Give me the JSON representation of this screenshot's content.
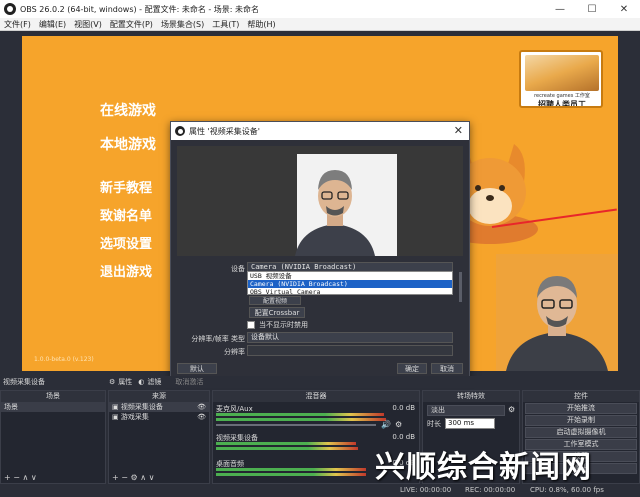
{
  "window": {
    "title": "OBS 26.0.2 (64-bit, windows) - 配置文件: 未命名 - 场景: 未命名",
    "minimize": "—",
    "maximize": "☐",
    "close": "✕"
  },
  "menu": [
    "文件(F)",
    "编辑(E)",
    "视图(V)",
    "配置文件(P)",
    "场景集合(S)",
    "工具(T)",
    "帮助(H)"
  ],
  "scene_menu": [
    "在线游戏",
    "本地游戏",
    "新手教程",
    "致谢名单",
    "选项设置",
    "退出游戏"
  ],
  "version_text": "1.0.0-beta.0 (v.123)",
  "badge": {
    "line1": "recreate games 工作室",
    "line2": "招聘人类员工"
  },
  "dialog": {
    "title": "属性 '视频采集设备'",
    "device_label": "设备",
    "device_value": "Camera (NVIDIA Broadcast)",
    "options": [
      "USB 视频设备",
      "Camera (NVIDIA Broadcast)",
      "OBS Virtual Camera"
    ],
    "hidden_btn": "配置视频",
    "crossbar_btn": "配置Crossbar",
    "checkbox_label": "当不显示时禁用",
    "res_type_label": "分辨率/帧率 类型",
    "res_type_value": "设备默认",
    "res_label": "分辨率",
    "default_btn": "默认",
    "ok_btn": "确定",
    "cancel_btn": "取消"
  },
  "source_bar": {
    "name": "视频采集设备",
    "props": "属性",
    "filters": "滤镜",
    "deactivate": "取消激活"
  },
  "docks": {
    "scenes": {
      "header": "场景",
      "items": [
        "场景"
      ],
      "footer": "+  −  ∧  ∨"
    },
    "sources": {
      "header": "来源",
      "items": [
        "视频采集设备",
        "游戏采集"
      ],
      "footer": "+  −  ⚙  ∧  ∨"
    },
    "mixer": {
      "header": "混音器",
      "channels": [
        {
          "name": "麦克风/Aux",
          "db": "0.0 dB"
        },
        {
          "name": "视频采集设备",
          "db": "0.0 dB"
        },
        {
          "name": "桌面音频",
          "db": "0.0 dB"
        }
      ]
    },
    "transitions": {
      "header": "转场特效",
      "type": "淡出",
      "duration_label": "时长",
      "duration": "300 ms"
    },
    "controls": {
      "header": "控件",
      "buttons": [
        "开始推流",
        "开始录制",
        "启动虚拟摄像机",
        "工作室模式",
        "设置",
        "退出"
      ]
    }
  },
  "status": {
    "live": "LIVE: 00:00:00",
    "rec": "REC: 00:00:00",
    "cpu": "CPU: 0.8%, 60.00 fps"
  },
  "watermark": "兴顺综合新闻网"
}
